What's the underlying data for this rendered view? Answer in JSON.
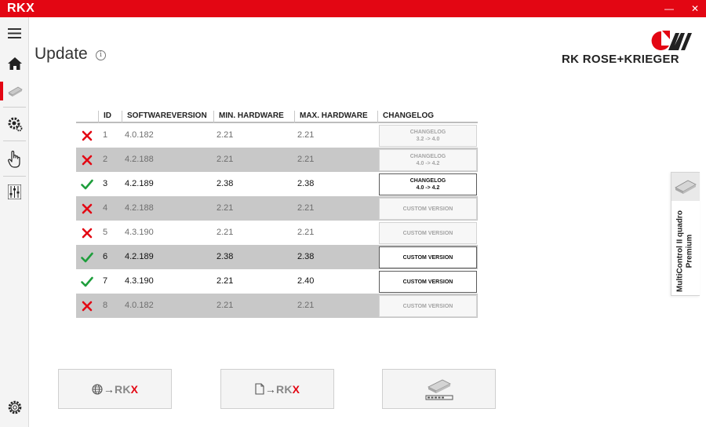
{
  "app": {
    "logo_text": "RKX",
    "window_controls": {
      "minimize": "—",
      "maximize": "☐",
      "close": "✕"
    }
  },
  "sidebar": {
    "items": [
      {
        "name": "menu",
        "icon": "hamburger-icon"
      },
      {
        "name": "home",
        "icon": "home-icon"
      },
      {
        "name": "update",
        "icon": "device-update-icon",
        "active": true
      },
      {
        "name": "settings",
        "icon": "gear-cog-icon"
      },
      {
        "name": "manual",
        "icon": "hand-pointer-icon"
      },
      {
        "name": "adjust",
        "icon": "sliders-icon"
      },
      {
        "name": "system",
        "icon": "gear-icon"
      }
    ]
  },
  "header": {
    "title": "Update",
    "info_icon": "i"
  },
  "brand": {
    "name": "RK ROSE+KRIEGER",
    "color": "#e30613"
  },
  "table": {
    "columns": [
      "ID",
      "SOFTWAREVERSION",
      "MIN. HARDWARE",
      "MAX. HARDWARE",
      "CHANGELOG"
    ],
    "rows": [
      {
        "id": "1",
        "software": "4.0.182",
        "min_hw": "2.21",
        "max_hw": "2.21",
        "compatible": false,
        "changelog": "CHANGELOG",
        "changelog_sub": "3.2 -> 4.0"
      },
      {
        "id": "2",
        "software": "4.2.188",
        "min_hw": "2.21",
        "max_hw": "2.21",
        "compatible": false,
        "changelog": "CHANGELOG",
        "changelog_sub": "4.0 -> 4.2"
      },
      {
        "id": "3",
        "software": "4.2.189",
        "min_hw": "2.38",
        "max_hw": "2.38",
        "compatible": true,
        "changelog": "CHANGELOG",
        "changelog_sub": "4.0 -> 4.2"
      },
      {
        "id": "4",
        "software": "4.2.188",
        "min_hw": "2.21",
        "max_hw": "2.21",
        "compatible": false,
        "changelog": "CUSTOM VERSION",
        "changelog_sub": ""
      },
      {
        "id": "5",
        "software": "4.3.190",
        "min_hw": "2.21",
        "max_hw": "2.21",
        "compatible": false,
        "changelog": "CUSTOM VERSION",
        "changelog_sub": ""
      },
      {
        "id": "6",
        "software": "4.2.189",
        "min_hw": "2.38",
        "max_hw": "2.38",
        "compatible": true,
        "changelog": "CUSTOM VERSION",
        "changelog_sub": ""
      },
      {
        "id": "7",
        "software": "4.3.190",
        "min_hw": "2.21",
        "max_hw": "2.40",
        "compatible": true,
        "changelog": "CUSTOM VERSION",
        "changelog_sub": ""
      },
      {
        "id": "8",
        "software": "4.0.182",
        "min_hw": "2.21",
        "max_hw": "2.21",
        "compatible": false,
        "changelog": "CUSTOM VERSION",
        "changelog_sub": ""
      }
    ],
    "status_colors": {
      "ok": "#1e9e3c",
      "fail": "#e30613"
    }
  },
  "actions": {
    "online_update": {
      "icon": "globe-icon",
      "arrow": "→",
      "label_main": "RK",
      "label_x": "X"
    },
    "file_update": {
      "icon": "file-icon",
      "arrow": "→",
      "label_main": "RK",
      "label_x": "X"
    },
    "device_update": {
      "icon": "device-progress-icon"
    }
  },
  "device_panel": {
    "label": "MultiControl II quadro Premium",
    "icon": "control-box-icon"
  }
}
